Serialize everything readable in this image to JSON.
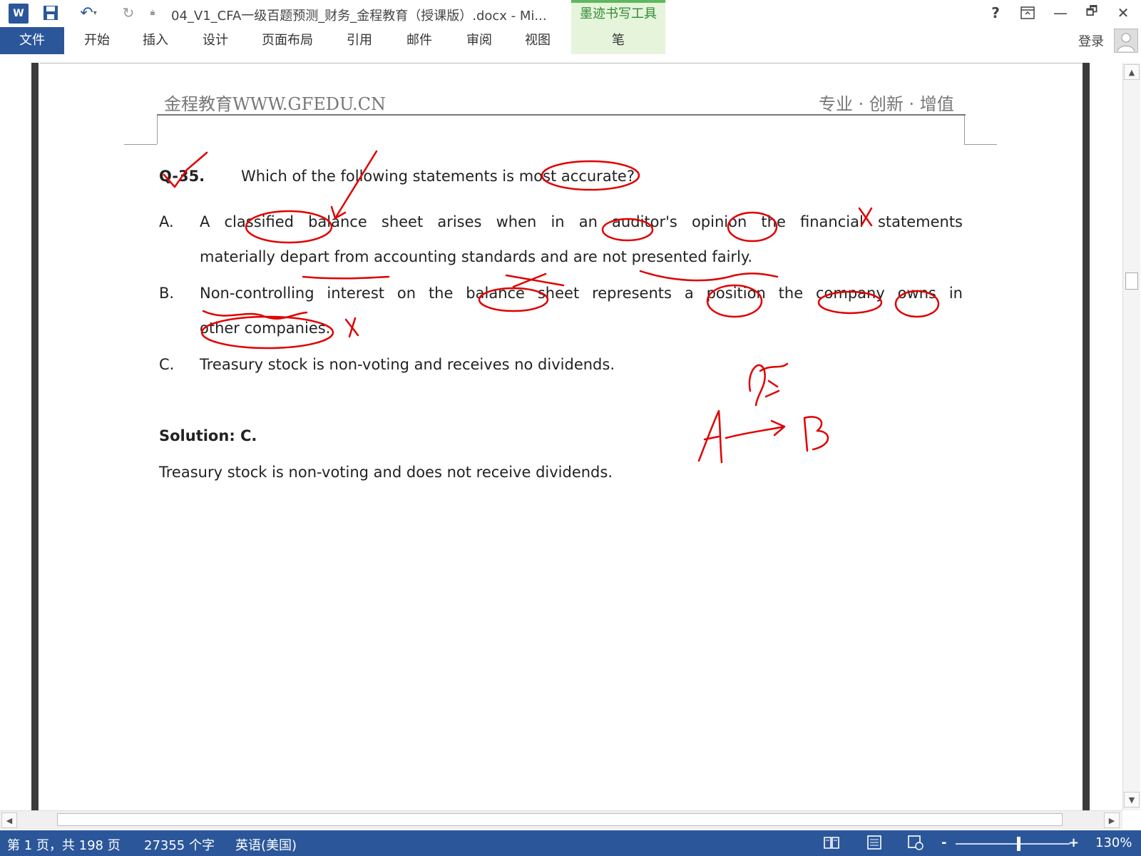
{
  "window": {
    "title": "04_V1_CFA一级百题预测_财务_金程教育（授课版）.docx - Mi...",
    "ink_tools_tab": "墨迹书写工具",
    "help": "?",
    "minimize": "—",
    "restore": "🗗",
    "close": "✕"
  },
  "ribbon": {
    "tabs": [
      {
        "label": "文件"
      },
      {
        "label": "开始"
      },
      {
        "label": "插入"
      },
      {
        "label": "设计"
      },
      {
        "label": "页面布局"
      },
      {
        "label": "引用"
      },
      {
        "label": "邮件"
      },
      {
        "label": "审阅"
      },
      {
        "label": "视图"
      },
      {
        "label": "笔"
      }
    ],
    "login": "登录"
  },
  "page": {
    "header_left": "金程教育WWW.GFEDU.CN",
    "header_right": "专业 · 创新 · 增值",
    "question_number": "Q-35.",
    "question_text": "Which of the following statements is most accurate?",
    "options": [
      {
        "letter": "A.",
        "line1": "A classified balance sheet arises when in an auditor's opinion the financial statements",
        "line2": "materially depart from accounting standards and are not presented fairly."
      },
      {
        "letter": "B.",
        "line1": "Non-controlling interest on the balance sheet represents a position the company owns in",
        "line2": "other companies."
      },
      {
        "letter": "C.",
        "line1": "Treasury stock is non-voting and receives no dividends.",
        "line2": ""
      }
    ],
    "solution_label": "Solution: C.",
    "solution_text": "Treasury stock is non-voting and does not receive dividends."
  },
  "statusbar": {
    "page_info": "第 1 页，共 198 页",
    "word_count": "27355 个字",
    "language": "英语(美国)",
    "zoom_minus": "-",
    "zoom_plus": "+",
    "zoom_level": "130%",
    "zoom_fraction": 0.55
  },
  "colors": {
    "accent": "#2b579a",
    "ink": "#e00000",
    "ink_tab": "#e6f4dc"
  }
}
